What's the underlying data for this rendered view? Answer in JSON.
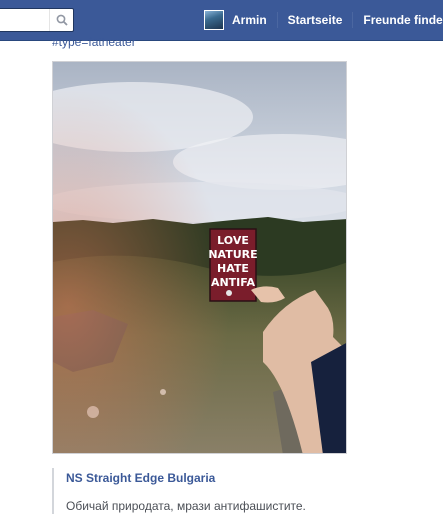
{
  "header": {
    "search": {
      "placeholder": "",
      "value": ""
    },
    "user_name": "Armin",
    "nav_items": [
      "Startseite",
      "Freunde finden"
    ]
  },
  "post": {
    "hashtag_text": "#type=fatheater",
    "photo": {
      "sign_lines": [
        "LOVE",
        "NATURE",
        "HATE",
        "ANTIFA"
      ]
    },
    "attachment": {
      "title": "NS Straight Edge Bulgaria",
      "description": "Обичай природата, мрази антифашистите."
    }
  },
  "colors": {
    "brand": "#3b5998",
    "link": "#3b5998",
    "text": "#4b4f56"
  }
}
